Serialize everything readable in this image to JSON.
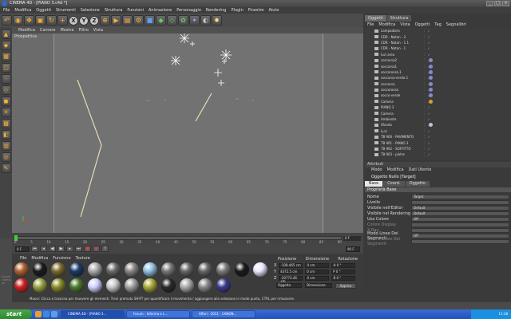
{
  "window": {
    "title": "CINEMA 4D - [PIANO 3.c4d *]"
  },
  "menubar": [
    "File",
    "Modifica",
    "Oggetti",
    "Strumenti",
    "Selezione",
    "Struttura",
    "Funzioni",
    "Animazione",
    "Personaggio",
    "Rendering",
    "Plugin",
    "Finestre",
    "Aiuto"
  ],
  "toolbar": {
    "icons": [
      "undo-icon",
      "live-select-icon",
      "move-icon",
      "scale-icon",
      "rotate-icon",
      "add-icon",
      "x-axis-icon",
      "y-axis-icon",
      "z-axis-icon",
      "world-coord-icon",
      "render-view-icon",
      "render-picture-icon",
      "render-settings-icon",
      "cube-icon",
      "subdivision-icon",
      "nurbs-icon",
      "array-icon",
      "deformer-icon",
      "scene-icon",
      "light-icon"
    ],
    "xyz": [
      "X",
      "Y",
      "Z"
    ]
  },
  "viewport": {
    "menu": [
      "Modifica",
      "Camere",
      "Mostra",
      "Filtro",
      "Vista"
    ],
    "label": "Prospettiva"
  },
  "timeline": {
    "ticks": [
      "0",
      "5",
      "10",
      "15",
      "20",
      "25",
      "30",
      "35",
      "40",
      "45",
      "50",
      "55",
      "60",
      "65",
      "70",
      "75",
      "80",
      "85",
      "90"
    ],
    "end_frame": "0 F",
    "start_field": "0 F",
    "end_field": "90 F"
  },
  "materials": {
    "menu": [
      "File",
      "Modifica",
      "Funzione",
      "Texture"
    ],
    "swatches": [
      "#b06030",
      "#1a1a1a",
      "#7a6a2a",
      "#1a3a6a",
      "#aaaaaa",
      "#6a6a6a",
      "#888888",
      "#8ec0e0",
      "#777777",
      "#666666",
      "#666666",
      "#7a7a7a",
      "#1a1a1a",
      "#e8e8ff",
      "#cc2222",
      "#9aa040",
      "#8a8a2a",
      "#4a7a30",
      "#cfd0ff",
      "#c8c8c8",
      "#a0a0a0",
      "#a8a838",
      "#2a2a2a",
      "#aaaaaa",
      "#888888",
      "#3a3a8a"
    ]
  },
  "coordinates": {
    "header": [
      "Posizione",
      "Dimensione",
      "Rotazione"
    ],
    "rows": [
      {
        "axis": "X",
        "pos": "-108.465 cm",
        "dim": "0 cm",
        "rot": "H 0 °"
      },
      {
        "axis": "Y",
        "pos": "4472.5 cm",
        "dim": "0 cm",
        "rot": "P 0 °"
      },
      {
        "axis": "Z",
        "pos": "-20773.46 cm",
        "dim": "0 cm",
        "rot": "B 0 °"
      }
    ],
    "mode": "Oggetto",
    "size_mode": "Dimensione",
    "apply": "Applica"
  },
  "status": "Muovi: Clicca e trascina per muovere gli elementi. Tieni premuto SHIFT per quantificare il movimento / aggiungere alla selezione in modo punto, CTRL per rimuovere.",
  "side_logo": "MAXON CINEMA 4D",
  "objects_panel": {
    "tabs": [
      "Oggetti",
      "Struttura"
    ],
    "menu": [
      "File",
      "Modifica",
      "Vista",
      "Oggetti",
      "Tag",
      "Segnalibri"
    ],
    "rows": [
      {
        "name": "Lampadario",
        "tag": ""
      },
      {
        "name": "CDR - Natan - 2",
        "tag": ""
      },
      {
        "name": "CDR - Natan - 1.1",
        "tag": ""
      },
      {
        "name": "CDR - Natan - 1",
        "tag": ""
      },
      {
        "name": "luci area",
        "tag": ""
      },
      {
        "name": "soccorsa2",
        "tag": "#8888cc"
      },
      {
        "name": "soccorsa1",
        "tag": "#8888cc"
      },
      {
        "name": "soccorossa.1",
        "tag": "#8888cc"
      },
      {
        "name": "soccorsa-verde.1",
        "tag": "#8888cc"
      },
      {
        "name": "soccorsa",
        "tag": "#8888cc"
      },
      {
        "name": "soccorossa",
        "tag": "#8888cc"
      },
      {
        "name": "socco-verde",
        "tag": "#8888cc"
      },
      {
        "name": "Camera",
        "tag": "#d8a020"
      },
      {
        "name": "PIANO 3",
        "tag": ""
      },
      {
        "name": "Camera",
        "tag": ""
      },
      {
        "name": "Ambiente",
        "tag": ""
      },
      {
        "name": "Sfondo",
        "tag": "#c0c0d8"
      },
      {
        "name": "Luci",
        "tag": ""
      },
      {
        "name": "TB 900 - PAVIMENTO",
        "tag": ""
      },
      {
        "name": "TB 901 - PIANO 3",
        "tag": ""
      },
      {
        "name": "TB 902 - SOFFITTO",
        "tag": ""
      },
      {
        "name": "TB 903 - pietre",
        "tag": ""
      }
    ]
  },
  "attributes": {
    "header": "Attributi",
    "menu": [
      "Modo",
      "Modifica",
      "Dati Utente"
    ],
    "title": "Oggetto Nullo [Target]",
    "tabs": [
      "Base",
      "Coord.",
      "Oggetto"
    ],
    "section": "Proprietà Base",
    "props": [
      {
        "label": "Nome",
        "value": "Target"
      },
      {
        "label": "Livello",
        "value": ""
      },
      {
        "label": "Visibile nell'Editor",
        "value": "Default"
      },
      {
        "label": "Visibile nel Rendering",
        "value": "Default"
      },
      {
        "label": "Usa Colore",
        "value": "Off"
      },
      {
        "label": "Colore Display",
        "value": ""
      },
      {
        "label": "X-Ray",
        "value": ""
      },
      {
        "label": "Modo Linee Dei Segmenti",
        "value": "Off"
      },
      {
        "label": "Colore Linee Dei Segmenti",
        "value": ""
      }
    ]
  },
  "taskbar": {
    "start": "start",
    "tasks": [
      "CINEMA 4D - [PIANO 3...",
      "Forum - Informa e L...",
      "Affari - 2011 - CANON..."
    ],
    "clock": "11:38"
  },
  "colors": {
    "accent": "#ffb030",
    "timeline_handle": "#3cd23c",
    "taskbar": "#2352b8",
    "start": "#3a983a"
  }
}
